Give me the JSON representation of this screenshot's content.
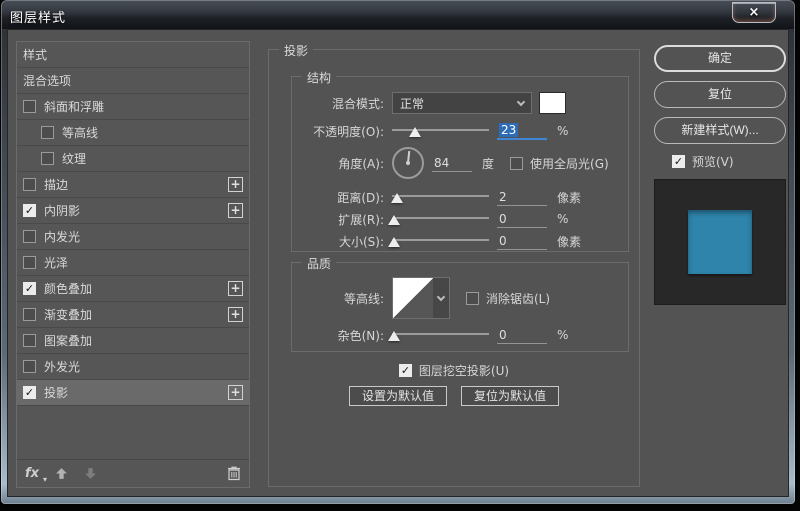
{
  "window": {
    "title": "图层样式",
    "close_glyph": "×"
  },
  "sidebar": {
    "items": [
      {
        "label": "样式",
        "has_checkbox": false,
        "checked": false,
        "indent": 0,
        "has_plus": false,
        "selected": false
      },
      {
        "label": "混合选项",
        "has_checkbox": false,
        "checked": false,
        "indent": 0,
        "has_plus": false,
        "selected": false
      },
      {
        "label": "斜面和浮雕",
        "has_checkbox": true,
        "checked": false,
        "indent": 0,
        "has_plus": false,
        "selected": false
      },
      {
        "label": "等高线",
        "has_checkbox": true,
        "checked": false,
        "indent": 1,
        "has_plus": false,
        "selected": false
      },
      {
        "label": "纹理",
        "has_checkbox": true,
        "checked": false,
        "indent": 1,
        "has_plus": false,
        "selected": false
      },
      {
        "label": "描边",
        "has_checkbox": true,
        "checked": false,
        "indent": 0,
        "has_plus": true,
        "selected": false
      },
      {
        "label": "内阴影",
        "has_checkbox": true,
        "checked": true,
        "indent": 0,
        "has_plus": true,
        "selected": false
      },
      {
        "label": "内发光",
        "has_checkbox": true,
        "checked": false,
        "indent": 0,
        "has_plus": false,
        "selected": false
      },
      {
        "label": "光泽",
        "has_checkbox": true,
        "checked": false,
        "indent": 0,
        "has_plus": false,
        "selected": false
      },
      {
        "label": "颜色叠加",
        "has_checkbox": true,
        "checked": true,
        "indent": 0,
        "has_plus": true,
        "selected": false
      },
      {
        "label": "渐变叠加",
        "has_checkbox": true,
        "checked": false,
        "indent": 0,
        "has_plus": true,
        "selected": false
      },
      {
        "label": "图案叠加",
        "has_checkbox": true,
        "checked": false,
        "indent": 0,
        "has_plus": false,
        "selected": false
      },
      {
        "label": "外发光",
        "has_checkbox": true,
        "checked": false,
        "indent": 0,
        "has_plus": false,
        "selected": false
      },
      {
        "label": "投影",
        "has_checkbox": true,
        "checked": true,
        "indent": 0,
        "has_plus": true,
        "selected": true
      }
    ],
    "footer": {
      "fx_label": "fx",
      "caret": "▾"
    }
  },
  "panel": {
    "group_title": "投影",
    "structure": {
      "title": "结构",
      "blend_mode": {
        "label": "混合模式:",
        "value": "正常"
      },
      "opacity": {
        "label": "不透明度(O):",
        "value": "23",
        "unit": "%",
        "pct": 24
      },
      "angle": {
        "label": "角度(A):",
        "value": "84",
        "unit": "度",
        "deg": 84
      },
      "global_light": {
        "label": "使用全局光(G)",
        "checked": false
      },
      "distance": {
        "label": "距离(D):",
        "value": "2",
        "unit": "像素",
        "pct": 5
      },
      "spread": {
        "label": "扩展(R):",
        "value": "0",
        "unit": "%",
        "pct": 2
      },
      "size": {
        "label": "大小(S):",
        "value": "0",
        "unit": "像素",
        "pct": 2
      }
    },
    "quality": {
      "title": "品质",
      "contour": {
        "label": "等高线:"
      },
      "antialias": {
        "label": "消除锯齿(L)",
        "checked": false
      },
      "noise": {
        "label": "杂色(N):",
        "value": "0",
        "unit": "%",
        "pct": 2
      }
    },
    "knockout": {
      "label": "图层挖空投影(U)",
      "checked": true
    },
    "buttons": {
      "make_default": "设置为默认值",
      "reset_default": "复位为默认值"
    }
  },
  "actions": {
    "ok": "确定",
    "reset": "复位",
    "new_style": "新建样式(W)...",
    "preview": {
      "label": "预览(V)",
      "checked": true
    }
  },
  "colors": {
    "preview_square": "#2e84aa",
    "blend_swatch": "#ffffff",
    "selection_blue": "#2d6db8",
    "underline_blue": "#3f86d6"
  },
  "check_glyph": "✓"
}
